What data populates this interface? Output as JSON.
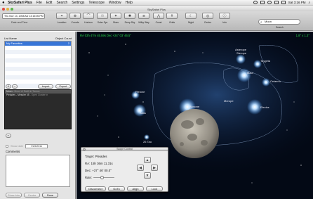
{
  "menubar": {
    "app_name": "SkySafari Plus",
    "items": [
      "File",
      "Edit",
      "Search",
      "Settings",
      "Telescope",
      "Window",
      "Help"
    ],
    "clock": "Sat 3:16 PM"
  },
  "window": {
    "title": "SkySafari Plus"
  },
  "toolbar": {
    "date_value": "Thu Nov 13, 2008 AD 13:15:06 PM",
    "date_caption": "Date and Time",
    "buttons": [
      {
        "label": "Location",
        "glyph": "⌖"
      },
      {
        "label": "Coords",
        "glyph": "⊕"
      },
      {
        "label": "Horizon",
        "glyph": "⌒"
      },
      {
        "label": "Solar Sys",
        "glyph": "☉"
      },
      {
        "label": "Stars",
        "glyph": "✦"
      },
      {
        "label": "Deep Sky",
        "glyph": "✺"
      },
      {
        "label": "Milky Way",
        "glyph": "≋"
      },
      {
        "label": "Const",
        "glyph": "⋀"
      },
      {
        "label": "Grids",
        "glyph": "#"
      },
      {
        "label": "Night",
        "glyph": "☾"
      },
      {
        "label": "Center",
        "glyph": "◎"
      },
      {
        "label": "Info",
        "glyph": "ⓘ"
      }
    ],
    "search_value": "Moon",
    "search_caption": "Search"
  },
  "sidebar": {
    "col_list_name": "List Name",
    "col_object_count": "Object Count",
    "lists": [
      {
        "name": "My Favorites",
        "count": "2"
      }
    ],
    "import_label": "Import",
    "export_label": "Export",
    "objects": [
      {
        "name": "Moon",
        "detail": "- Moon of Earth in Taurus"
      },
      {
        "name": "Pleiades - Messier 45",
        "detail": "- Open Cluster in"
      }
    ],
    "show_date_label": "Show date",
    "show_date_value": "7/23/2011",
    "comments_label": "Comments",
    "btn_show_info": "Show Info",
    "btn_center": "Center",
    "btn_done": "Done"
  },
  "sky": {
    "radec_readout": "RA 03h 47m 45.59s Dec +24° 03' 46.5\"",
    "fov_readout": "1.8° x 1.3°",
    "star_labels": [
      "Asterope",
      "Sterope",
      "Taygeta",
      "Maia",
      "Celaeno",
      "Pleione",
      "Atlas",
      "Alcyone",
      "Merope",
      "Electra",
      "26 Tau"
    ]
  },
  "scope_control": {
    "title": "Scope Control",
    "target_line": "Target: Pleiades",
    "ra_line": "RA:  15h 36m 11.31s",
    "dec_line": "Dec: +37° 46' 00.0\"",
    "rate_label": "Rate:",
    "rate_level": 0.4,
    "btn_disconnect": "Disconnect",
    "btn_goto": "GoTo",
    "btn_align": "Align",
    "btn_lock": "Lock"
  }
}
